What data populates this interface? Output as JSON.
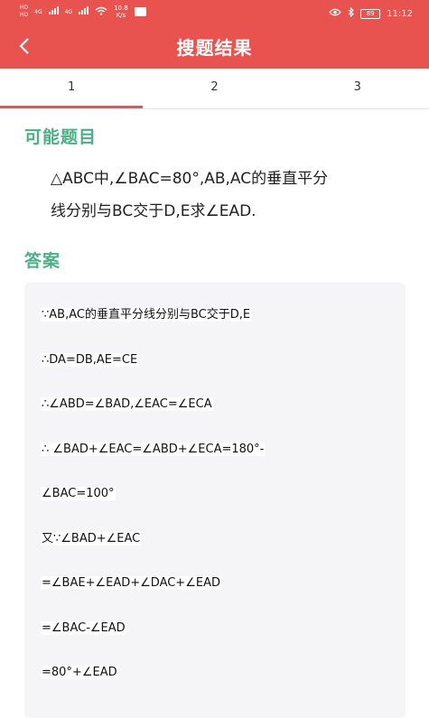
{
  "status_bar": {
    "hd_top": "HD",
    "hd_bottom": "HD",
    "network_1": "4G",
    "network_2": "4G",
    "speed_value": "10.8",
    "speed_unit": "K/s",
    "battery": "89",
    "time": "11:12"
  },
  "header": {
    "back_icon": "chevron-left-icon",
    "title": "搜题结果",
    "background": "#e8534f"
  },
  "tabs": [
    "1",
    "2",
    "3"
  ],
  "active_tab": "1",
  "question_section": {
    "title": "可能题目",
    "lines": [
      "△ABC中,∠BAC=80°,AB,AC的垂直平分",
      "线分别与BC交于D,E求∠EAD."
    ]
  },
  "answer_section": {
    "title": "答案",
    "lines": [
      "∵AB,AC的垂直平分线分别与BC交于D,E",
      "∴DA=DB,AE=CE",
      "∴∠ABD=∠BAD,∠EAC=∠ECA",
      "∴ ∠BAD+∠EAC=∠ABD+∠ECA=180°-",
      "∠BAC=100°",
      "又∵∠BAD+∠EAC",
      "=∠BAE+∠EAD+∠DAC+∠EAD",
      "=∠BAC-∠EAD",
      "=80°+∠EAD"
    ]
  },
  "colors": {
    "accent": "#e8534f",
    "section_title": "#4caf88",
    "card_bg": "#f5f5f7"
  }
}
